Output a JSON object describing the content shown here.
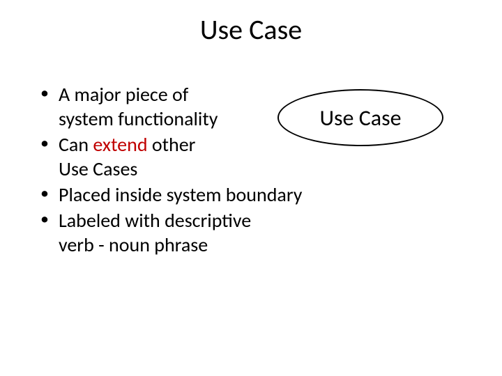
{
  "title": "Use Case",
  "bullets": [
    {
      "lines": [
        {
          "text": "A major piece of"
        },
        {
          "text": "system functionality"
        }
      ]
    },
    {
      "lines": [
        {
          "prefix": "Can ",
          "emph": "extend",
          "suffix": " other"
        },
        {
          "text": "Use Cases"
        }
      ]
    },
    {
      "lines": [
        {
          "text": "Placed inside system boundary"
        }
      ]
    },
    {
      "lines": [
        {
          "text": "Labeled with descriptive"
        },
        {
          "text": "verb - noun phrase"
        }
      ]
    }
  ],
  "diagram": {
    "oval_label": "Use Case"
  },
  "colors": {
    "emphasis": "#C00000"
  }
}
